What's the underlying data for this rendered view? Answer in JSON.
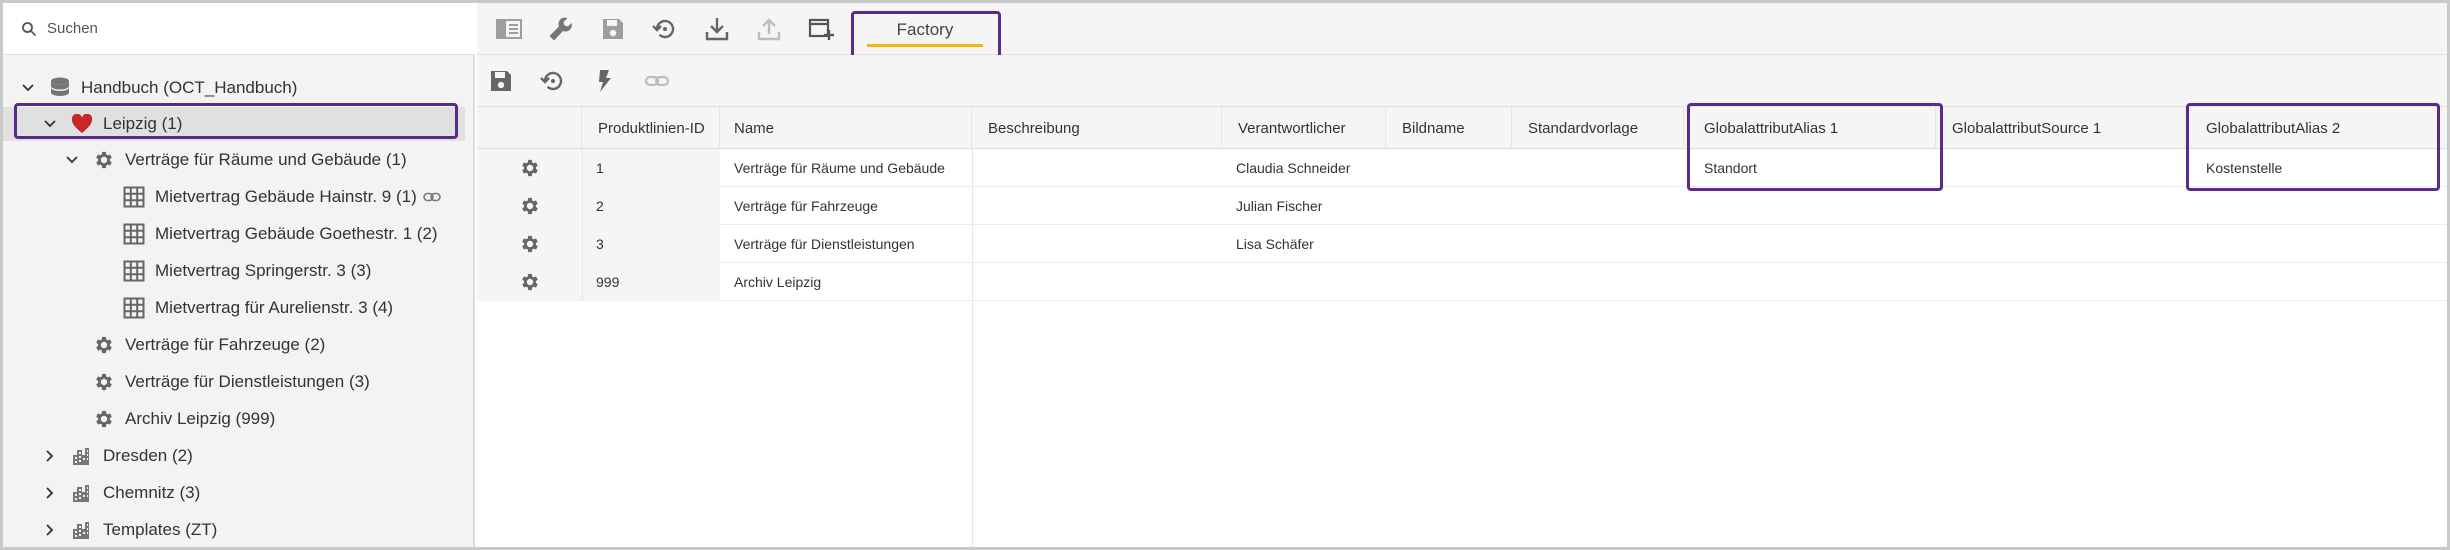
{
  "search": {
    "placeholder": "Suchen"
  },
  "tree": {
    "root": {
      "label": "Handbuch (OCT_Handbuch)",
      "icon": "database-icon"
    },
    "leipzig": {
      "label": "Leipzig (1)",
      "icon": "heart-icon"
    },
    "vertraege_raeume": {
      "label": "Verträge für Räume und Gebäude (1)",
      "icon": "gear-icon"
    },
    "items": [
      {
        "label": "Mietvertrag Gebäude Hainstr. 9 (1)",
        "icon": "table-icon",
        "linked": true
      },
      {
        "label": "Mietvertrag Gebäude Goethestr. 1 (2)",
        "icon": "table-icon",
        "linked": false
      },
      {
        "label": "Mietvertrag Springerstr. 3 (3)",
        "icon": "table-icon",
        "linked": false
      },
      {
        "label": "Mietvertrag für Aurelienstr. 3 (4)",
        "icon": "table-icon",
        "linked": false
      }
    ],
    "vertraege_fahrzeuge": {
      "label": "Verträge für Fahrzeuge (2)",
      "icon": "gear-icon"
    },
    "vertraege_dienst": {
      "label": "Verträge für Dienstleistungen (3)",
      "icon": "gear-icon"
    },
    "archiv": {
      "label": "Archiv Leipzig (999)",
      "icon": "gear-icon"
    },
    "dresden": {
      "label": "Dresden (2)",
      "icon": "city-icon"
    },
    "chemnitz": {
      "label": "Chemnitz (3)",
      "icon": "city-icon"
    },
    "templates": {
      "label": "Templates (ZT)",
      "icon": "city-icon"
    }
  },
  "toolbar": {
    "tab_label": "Factory",
    "accent": "#f5b416",
    "highlight": "#5c2a8a",
    "favorite": "#c62828"
  },
  "grid": {
    "columns": [
      "Produktlinien-ID",
      "Name",
      "Beschreibung",
      "Verantwortlicher",
      "Bildname",
      "Standardvorlage",
      "GlobalattributAlias 1",
      "GlobalattributSource 1",
      "GlobalattributAlias 2"
    ],
    "rows": [
      {
        "id": "1",
        "name": "Verträge für Räume und Gebäude",
        "beschreibung": "",
        "verantwortlicher": "Claudia Schneider",
        "bildname": "",
        "standardvorlage": "",
        "alias1": "Standort",
        "source1": "",
        "alias2": "Kostenstelle"
      },
      {
        "id": "2",
        "name": "Verträge für Fahrzeuge",
        "beschreibung": "",
        "verantwortlicher": "Julian Fischer",
        "bildname": "",
        "standardvorlage": "",
        "alias1": "",
        "source1": "",
        "alias2": ""
      },
      {
        "id": "3",
        "name": "Verträge für Dienstleistungen",
        "beschreibung": "",
        "verantwortlicher": "Lisa Schäfer",
        "bildname": "",
        "standardvorlage": "",
        "alias1": "",
        "source1": "",
        "alias2": ""
      },
      {
        "id": "999",
        "name": "Archiv Leipzig",
        "beschreibung": "",
        "verantwortlicher": "",
        "bildname": "",
        "standardvorlage": "",
        "alias1": "",
        "source1": "",
        "alias2": ""
      }
    ]
  }
}
